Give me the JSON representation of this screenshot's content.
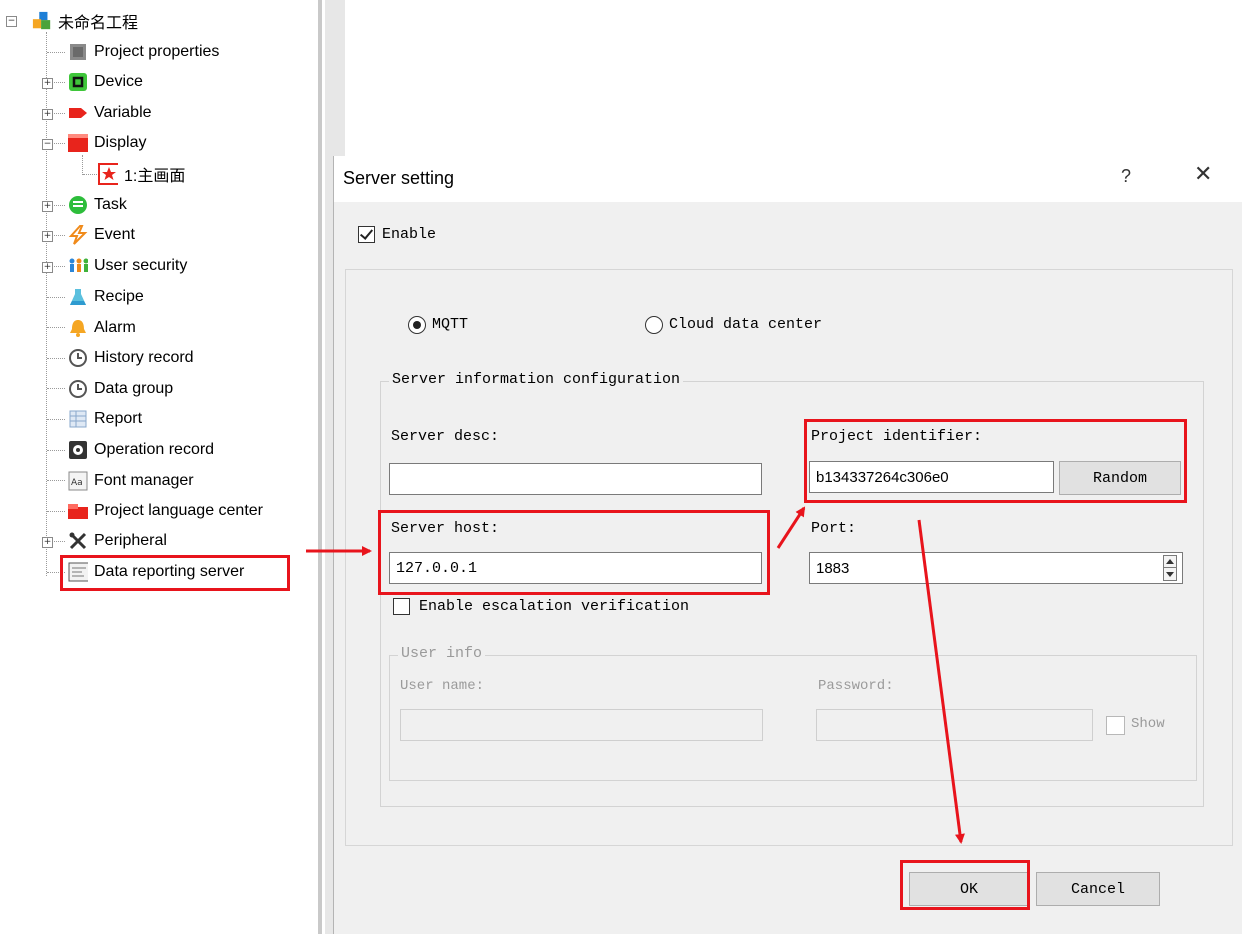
{
  "tree": {
    "root": "未命名工程",
    "items": [
      {
        "label": "Project properties",
        "icon": "project-properties-icon"
      },
      {
        "label": "Device",
        "icon": "device-icon"
      },
      {
        "label": "Variable",
        "icon": "variable-icon"
      },
      {
        "label": "Display",
        "icon": "display-icon"
      },
      {
        "label": "1:主画面",
        "icon": "screen-icon"
      },
      {
        "label": "Task",
        "icon": "task-icon"
      },
      {
        "label": "Event",
        "icon": "event-icon"
      },
      {
        "label": "User security",
        "icon": "user-security-icon"
      },
      {
        "label": "Recipe",
        "icon": "recipe-icon"
      },
      {
        "label": "Alarm",
        "icon": "alarm-icon"
      },
      {
        "label": "History record",
        "icon": "history-record-icon"
      },
      {
        "label": "Data group",
        "icon": "data-group-icon"
      },
      {
        "label": "Report",
        "icon": "report-icon"
      },
      {
        "label": "Operation record",
        "icon": "operation-record-icon"
      },
      {
        "label": "Font manager",
        "icon": "font-manager-icon"
      },
      {
        "label": "Project language center",
        "icon": "language-center-icon"
      },
      {
        "label": "Peripheral",
        "icon": "peripheral-icon"
      },
      {
        "label": "Data reporting server",
        "icon": "data-reporting-server-icon"
      }
    ]
  },
  "dialog": {
    "title": "Server setting",
    "help": "?",
    "close": "✕",
    "enable_label": "Enable",
    "enable_checked": true,
    "protocol": {
      "mqtt_label": "MQTT",
      "cloud_label": "Cloud data center",
      "selected": "MQTT"
    },
    "server_group": {
      "title": "Server information configuration",
      "server_desc_label": "Server desc:",
      "server_desc_value": "",
      "project_identifier_label": "Project identifier:",
      "project_identifier_value": "b134337264c306e0",
      "random_label": "Random",
      "server_host_label": "Server host:",
      "server_host_value": "127.0.0.1",
      "port_label": "Port:",
      "port_value": "1883",
      "escalation_label": "Enable escalation verification",
      "escalation_checked": false
    },
    "user_info": {
      "title": "User info",
      "user_name_label": "User name:",
      "password_label": "Password:",
      "show_label": "Show"
    },
    "ok_label": "OK",
    "cancel_label": "Cancel"
  },
  "colors": {
    "highlight": "#e8141c",
    "dialog_bg": "#f0f0f0"
  }
}
